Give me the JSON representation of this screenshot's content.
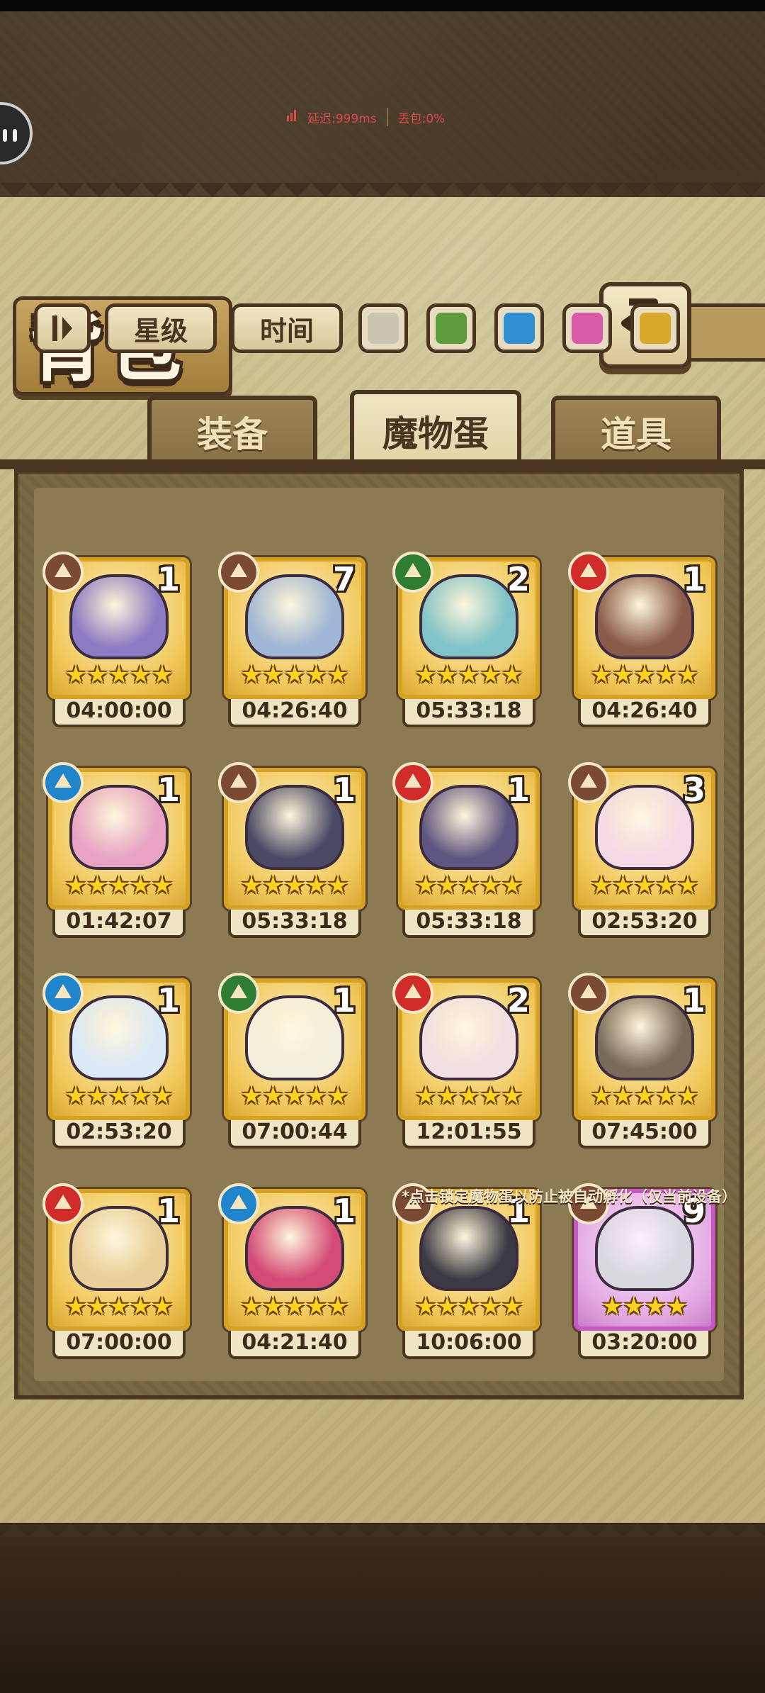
{
  "status": {
    "latency_label": "延迟:999ms",
    "loss_label": "丢包:0%"
  },
  "header": {
    "title": "背包",
    "back_icon": "return-arrow-icon"
  },
  "tabs": [
    {
      "label": "装备",
      "active": false
    },
    {
      "label": "魔物蛋",
      "active": true
    },
    {
      "label": "道具",
      "active": false
    }
  ],
  "filters": {
    "sort_icon": "sort-toggle-icon",
    "star_label": "星级",
    "time_label": "时间",
    "colors": [
      "#c9c4b3",
      "#5e9c3b",
      "#2f8fd0",
      "#d65aa8",
      "#d8a92a"
    ]
  },
  "eggs": [
    {
      "element": "earth",
      "count": "1",
      "stars": "★★★★★",
      "timer": "04:00:00",
      "color": "#8b7bc4",
      "frame": "gold"
    },
    {
      "element": "earth",
      "count": "7",
      "stars": "★★★★★",
      "timer": "04:26:40",
      "color": "#9fb6d6",
      "frame": "gold"
    },
    {
      "element": "grass",
      "count": "2",
      "stars": "★★★★★",
      "timer": "05:33:18",
      "color": "#7fc3c9",
      "frame": "gold"
    },
    {
      "element": "fire",
      "count": "1",
      "stars": "★★★★★",
      "timer": "04:26:40",
      "color": "#8a5a4a",
      "frame": "gold"
    },
    {
      "element": "water",
      "count": "1",
      "stars": "★★★★★",
      "timer": "01:42:07",
      "color": "#e7a2c4",
      "frame": "gold"
    },
    {
      "element": "earth",
      "count": "1",
      "stars": "★★★★★",
      "timer": "05:33:18",
      "color": "#4a4a66",
      "frame": "gold"
    },
    {
      "element": "fire",
      "count": "1",
      "stars": "★★★★★",
      "timer": "05:33:18",
      "color": "#5e5580",
      "frame": "gold"
    },
    {
      "element": "earth",
      "count": "3",
      "stars": "★★★★★",
      "timer": "02:53:20",
      "color": "#f5d9e6",
      "frame": "gold"
    },
    {
      "element": "water",
      "count": "1",
      "stars": "★★★★★",
      "timer": "02:53:20",
      "color": "#dbe9f7",
      "frame": "gold"
    },
    {
      "element": "grass",
      "count": "1",
      "stars": "★★★★★",
      "timer": "07:00:44",
      "color": "#f2efdc",
      "frame": "gold"
    },
    {
      "element": "fire",
      "count": "2",
      "stars": "★★★★★",
      "timer": "12:01:55",
      "color": "#f1dfe2",
      "frame": "gold"
    },
    {
      "element": "earth",
      "count": "1",
      "stars": "★★★★★",
      "timer": "07:45:00",
      "color": "#7a6a5a",
      "frame": "gold"
    },
    {
      "element": "fire",
      "count": "1",
      "stars": "★★★★★",
      "timer": "07:00:00",
      "color": "#e9cf98",
      "frame": "gold"
    },
    {
      "element": "water",
      "count": "1",
      "stars": "★★★★★",
      "timer": "04:21:40",
      "color": "#d44a76",
      "frame": "gold"
    },
    {
      "element": "earth",
      "count": "1",
      "stars": "★★★★★",
      "timer": "10:06:00",
      "color": "#3b3a44",
      "frame": "gold"
    },
    {
      "element": "earth",
      "count": "9",
      "stars": "★★★★",
      "timer": "03:20:00",
      "color": "#d8d8de",
      "frame": "purple"
    }
  ],
  "footer_note": "*点击锁定魔物蛋以防止被自动孵化（仅当前设备）"
}
